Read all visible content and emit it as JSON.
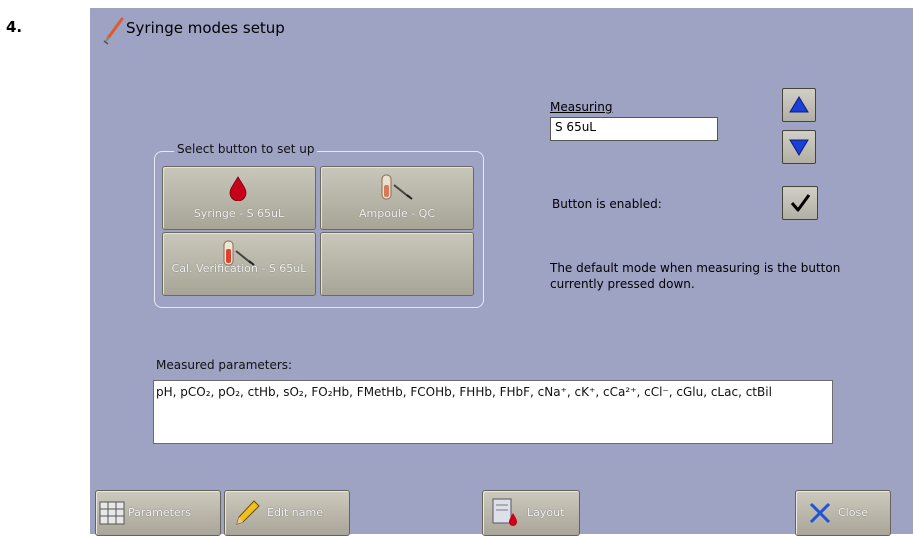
{
  "step_label": "4.",
  "window": {
    "title": "Syringe modes setup",
    "icon": "syringe-icon"
  },
  "select_group": {
    "legend": "Select button to set up",
    "buttons": [
      {
        "label": "Syringe - S 65uL",
        "icon": "blood-drop-icon",
        "pressed": false
      },
      {
        "label": "Ampoule - QC",
        "icon": "ampoule-icon",
        "pressed": false
      },
      {
        "label": "Cal. Verification - S 65uL",
        "icon": "cal-verification-icon",
        "pressed": false
      },
      {
        "label": "",
        "icon": "",
        "pressed": false
      }
    ]
  },
  "measuring": {
    "label": "Measuring",
    "value": "S 65uL"
  },
  "enabled_text": "Button is enabled:",
  "enabled_checked": true,
  "default_mode_note": "The default mode when measuring is the button currently pressed down.",
  "measured_parameters": {
    "label": "Measured parameters:",
    "value": "pH, pCO₂, pO₂, ctHb, sO₂, FO₂Hb, FMetHb, FCOHb, FHHb, FHbF, cNa⁺, cK⁺, cCa²⁺, cCl⁻, cGlu, cLac, ctBil"
  },
  "bottom_buttons": {
    "parameters": "Parameters",
    "edit_name": "Edit name",
    "layout": "Layout",
    "close": "Close"
  },
  "colors": {
    "screen_bg": "#9ea2c3",
    "button_face": "#b8b6a9",
    "up_arrow": "#1c3fd8",
    "down_arrow": "#1c3fd8",
    "close_x": "#1f55d6",
    "blood": "#c8001a"
  }
}
